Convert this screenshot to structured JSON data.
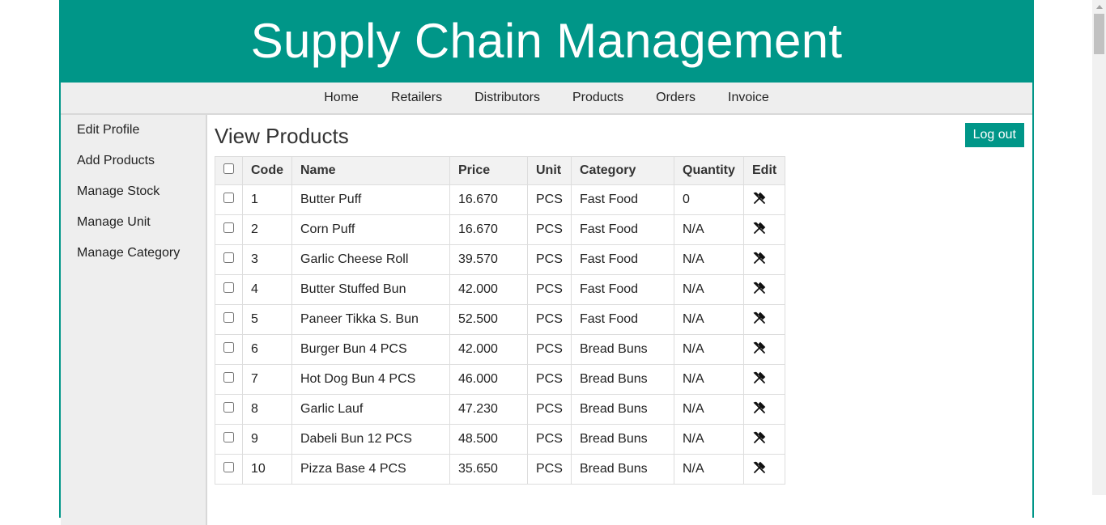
{
  "header": {
    "title": "Supply Chain Management"
  },
  "nav": {
    "items": [
      {
        "label": "Home"
      },
      {
        "label": "Retailers"
      },
      {
        "label": "Distributors"
      },
      {
        "label": "Products"
      },
      {
        "label": "Orders"
      },
      {
        "label": "Invoice"
      }
    ]
  },
  "sidebar": {
    "items": [
      {
        "label": "Edit Profile"
      },
      {
        "label": "Add Products"
      },
      {
        "label": "Manage Stock"
      },
      {
        "label": "Manage Unit"
      },
      {
        "label": "Manage Category"
      }
    ]
  },
  "main": {
    "title": "View Products",
    "logout_label": "Log out"
  },
  "table": {
    "headers": [
      "Code",
      "Name",
      "Price",
      "Unit",
      "Category",
      "Quantity",
      "Edit"
    ],
    "rows": [
      {
        "code": "1",
        "name": "Butter Puff",
        "price": "16.670",
        "unit": "PCS",
        "category": "Fast Food",
        "quantity": "0"
      },
      {
        "code": "2",
        "name": "Corn Puff",
        "price": "16.670",
        "unit": "PCS",
        "category": "Fast Food",
        "quantity": "N/A"
      },
      {
        "code": "3",
        "name": "Garlic Cheese Roll",
        "price": "39.570",
        "unit": "PCS",
        "category": "Fast Food",
        "quantity": "N/A"
      },
      {
        "code": "4",
        "name": "Butter Stuffed Bun",
        "price": "42.000",
        "unit": "PCS",
        "category": "Fast Food",
        "quantity": "N/A"
      },
      {
        "code": "5",
        "name": "Paneer Tikka S. Bun",
        "price": "52.500",
        "unit": "PCS",
        "category": "Fast Food",
        "quantity": "N/A"
      },
      {
        "code": "6",
        "name": "Burger Bun 4 PCS",
        "price": "42.000",
        "unit": "PCS",
        "category": "Bread Buns",
        "quantity": "N/A"
      },
      {
        "code": "7",
        "name": "Hot Dog Bun 4 PCS",
        "price": "46.000",
        "unit": "PCS",
        "category": "Bread Buns",
        "quantity": "N/A"
      },
      {
        "code": "8",
        "name": "Garlic Lauf",
        "price": "47.230",
        "unit": "PCS",
        "category": "Bread Buns",
        "quantity": "N/A"
      },
      {
        "code": "9",
        "name": "Dabeli Bun 12 PCS",
        "price": "48.500",
        "unit": "PCS",
        "category": "Bread Buns",
        "quantity": "N/A"
      },
      {
        "code": "10",
        "name": "Pizza Base 4 PCS",
        "price": "35.650",
        "unit": "PCS",
        "category": "Bread Buns",
        "quantity": "N/A"
      }
    ],
    "edit_icon": "tools-icon"
  },
  "colors": {
    "brand": "#009688",
    "nav_bg": "#eeeeee",
    "header_text": "#ffffff"
  }
}
